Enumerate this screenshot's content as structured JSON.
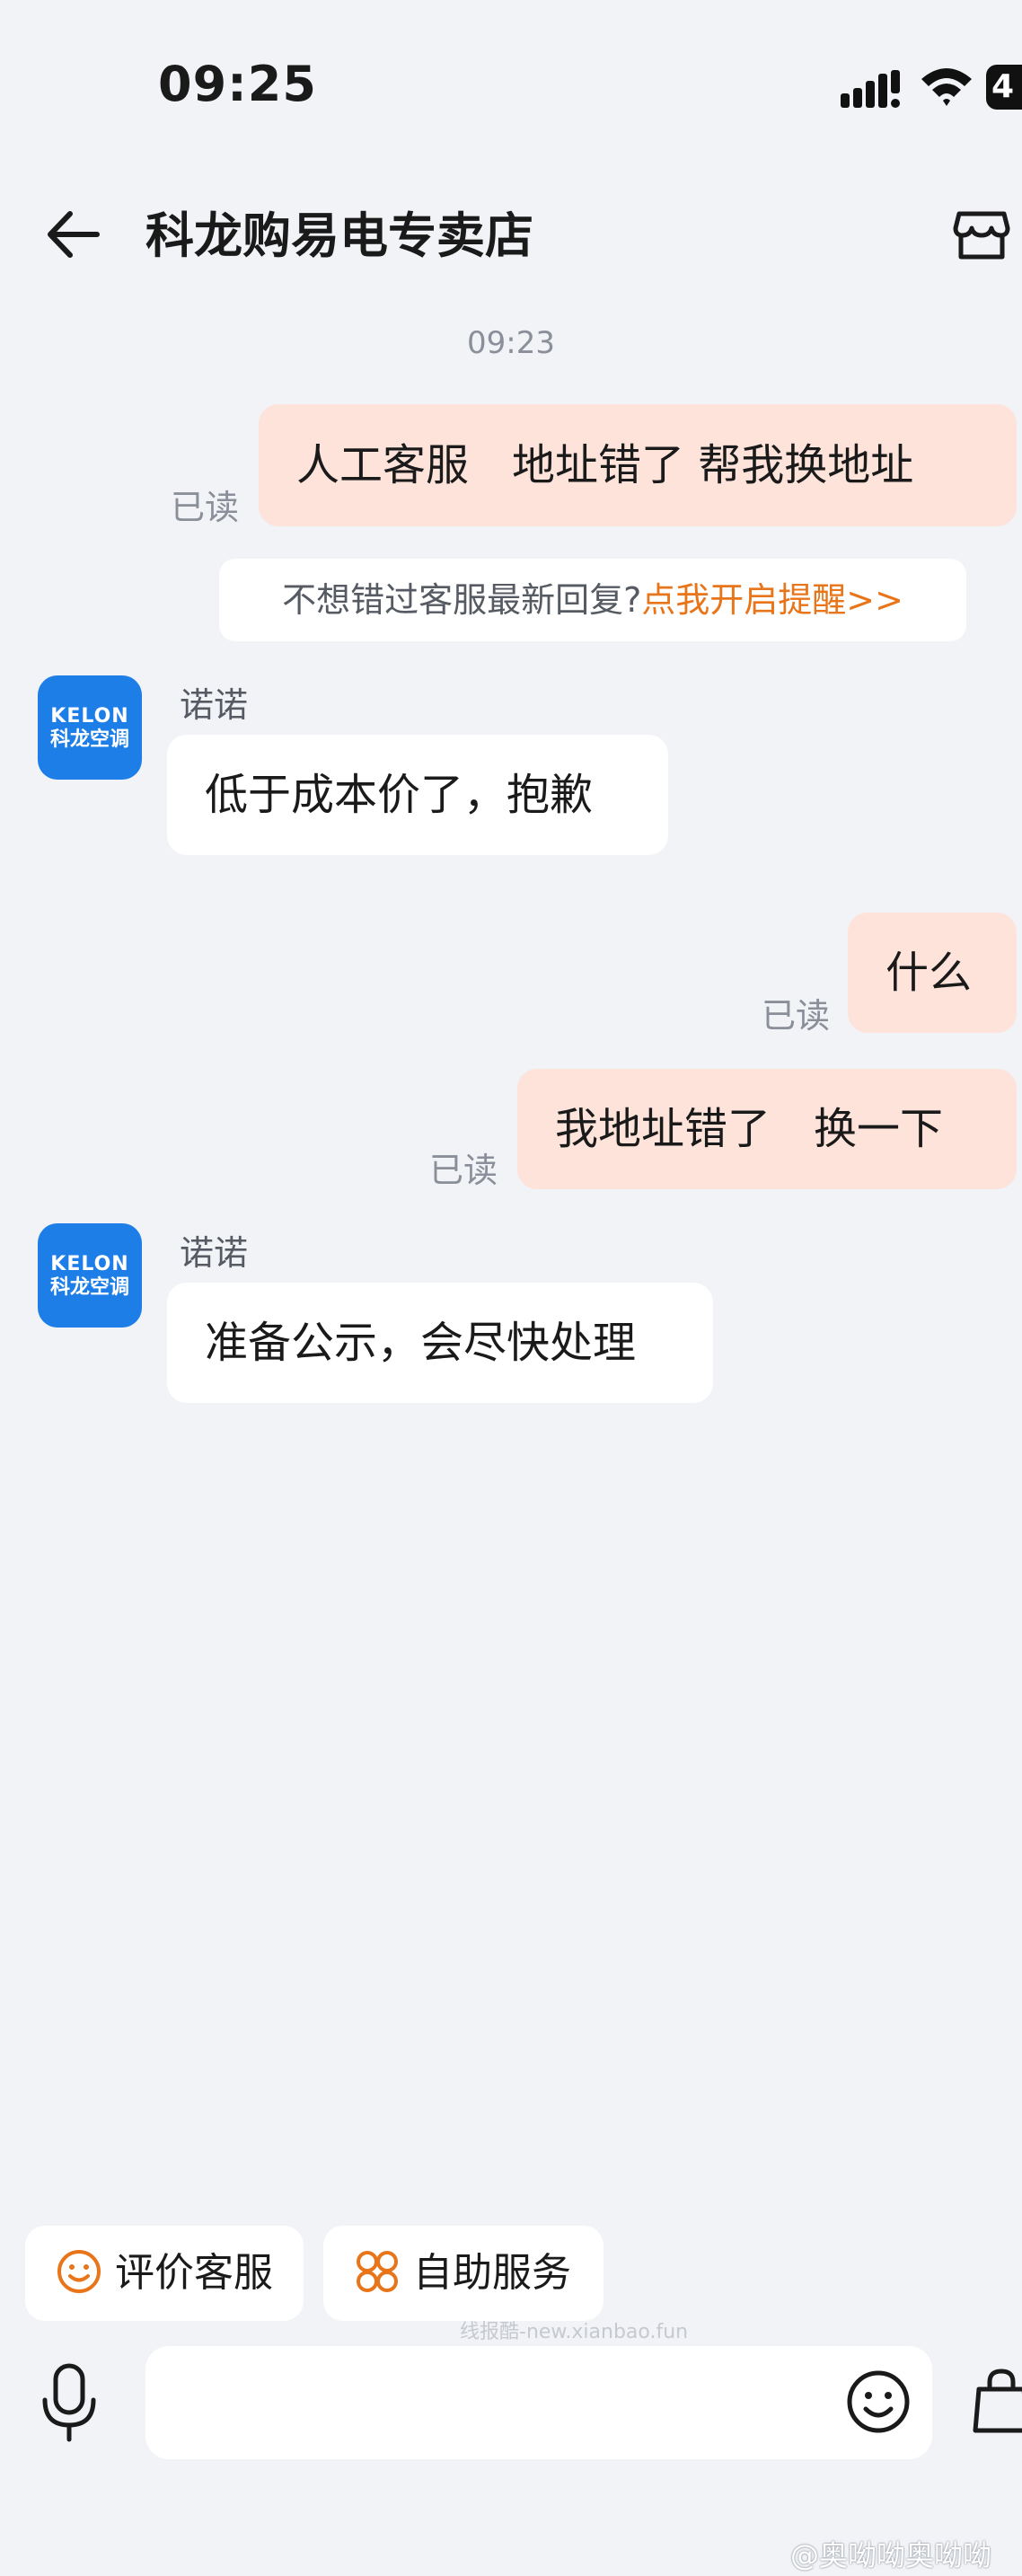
{
  "status_bar": {
    "time": "09:25",
    "battery": "4"
  },
  "header": {
    "title": "科龙购易电专卖店"
  },
  "chat": {
    "timestamp": "09:23",
    "messages": [
      {
        "id": "m1",
        "text": "人工客服　地址错了  帮我换地址",
        "read": "已读"
      },
      {
        "id": "m2",
        "sender": "诺诺",
        "text": "低于成本价了，抱歉"
      },
      {
        "id": "m3",
        "text": "什么",
        "read": "已读"
      },
      {
        "id": "m4",
        "text": "我地址错了　换一下",
        "read": "已读"
      },
      {
        "id": "m5",
        "sender": "诺诺",
        "text": "准备公示，会尽快处理"
      }
    ],
    "notice": {
      "text": "不想错过客服最新回复?",
      "link": "点我开启提醒>>"
    },
    "avatar": {
      "brand": "KELON",
      "brand_cn": "科龙空调",
      "color": "#1e7ee8"
    }
  },
  "quick_actions": [
    {
      "label": "评价客服",
      "icon": "smile-icon"
    },
    {
      "label": "自助服务",
      "icon": "grid-icon"
    }
  ],
  "watermarks": {
    "mid": "线报酷-new.xianbao.fun",
    "bottom": "@奥呦呦奥呦呦"
  },
  "colors": {
    "accent": "#e8751a",
    "out_bubble": "#fde3da",
    "background": "#f1f3f7"
  }
}
